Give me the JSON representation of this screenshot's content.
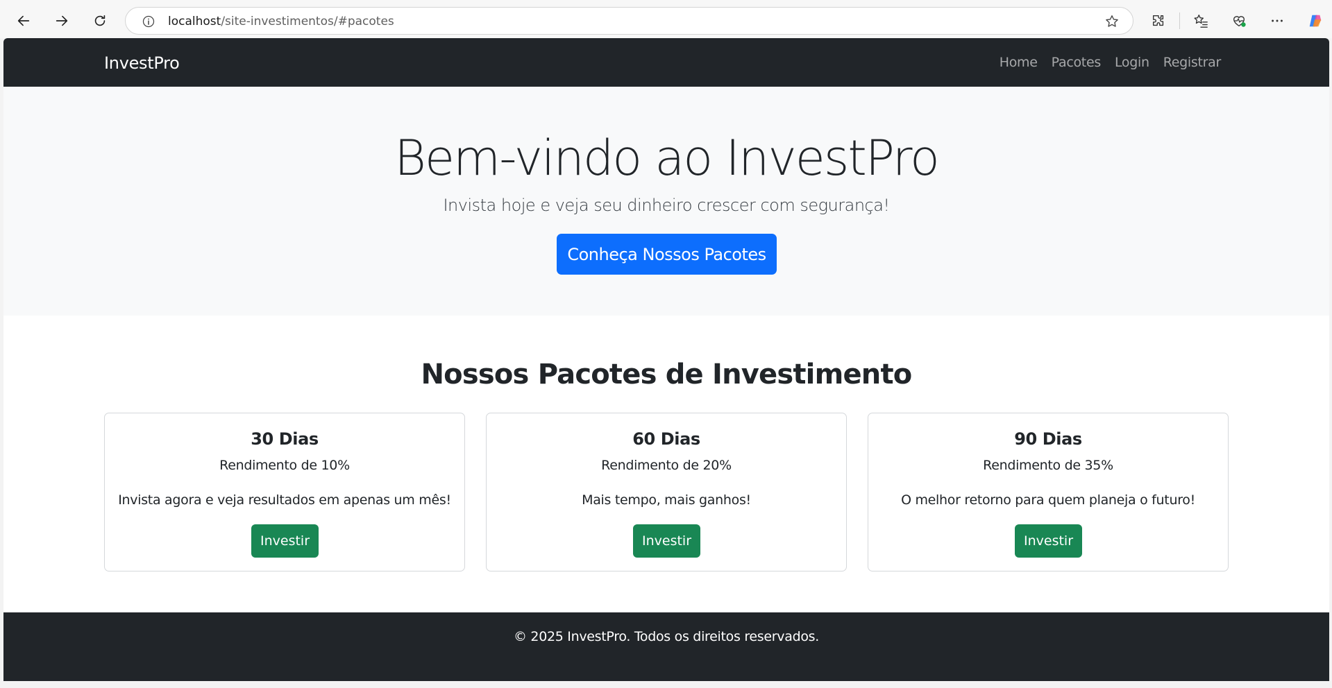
{
  "browser": {
    "url_host": "localhost",
    "url_path": "/site-investimentos/#pacotes"
  },
  "navbar": {
    "brand": "InvestPro",
    "links": [
      "Home",
      "Pacotes",
      "Login",
      "Registrar"
    ]
  },
  "hero": {
    "title": "Bem-vindo ao InvestPro",
    "subtitle": "Invista hoje e veja seu dinheiro crescer com segurança!",
    "cta_label": "Conheça Nossos Pacotes"
  },
  "packages": {
    "title": "Nossos Pacotes de Investimento",
    "items": [
      {
        "title": "30 Dias",
        "yield": "Rendimento de 10%",
        "description": "Invista agora e veja resultados em apenas um mês!",
        "button": "Investir"
      },
      {
        "title": "60 Dias",
        "yield": "Rendimento de 20%",
        "description": "Mais tempo, mais ganhos!",
        "button": "Investir"
      },
      {
        "title": "90 Dias",
        "yield": "Rendimento de 35%",
        "description": "O melhor retorno para quem planeja o futuro!",
        "button": "Investir"
      }
    ]
  },
  "footer": {
    "text": "© 2025 InvestPro. Todos os direitos reservados."
  },
  "colors": {
    "dark": "#212529",
    "primary": "#0d6efd",
    "success": "#198754",
    "hero_bg": "#f8f9fa"
  }
}
